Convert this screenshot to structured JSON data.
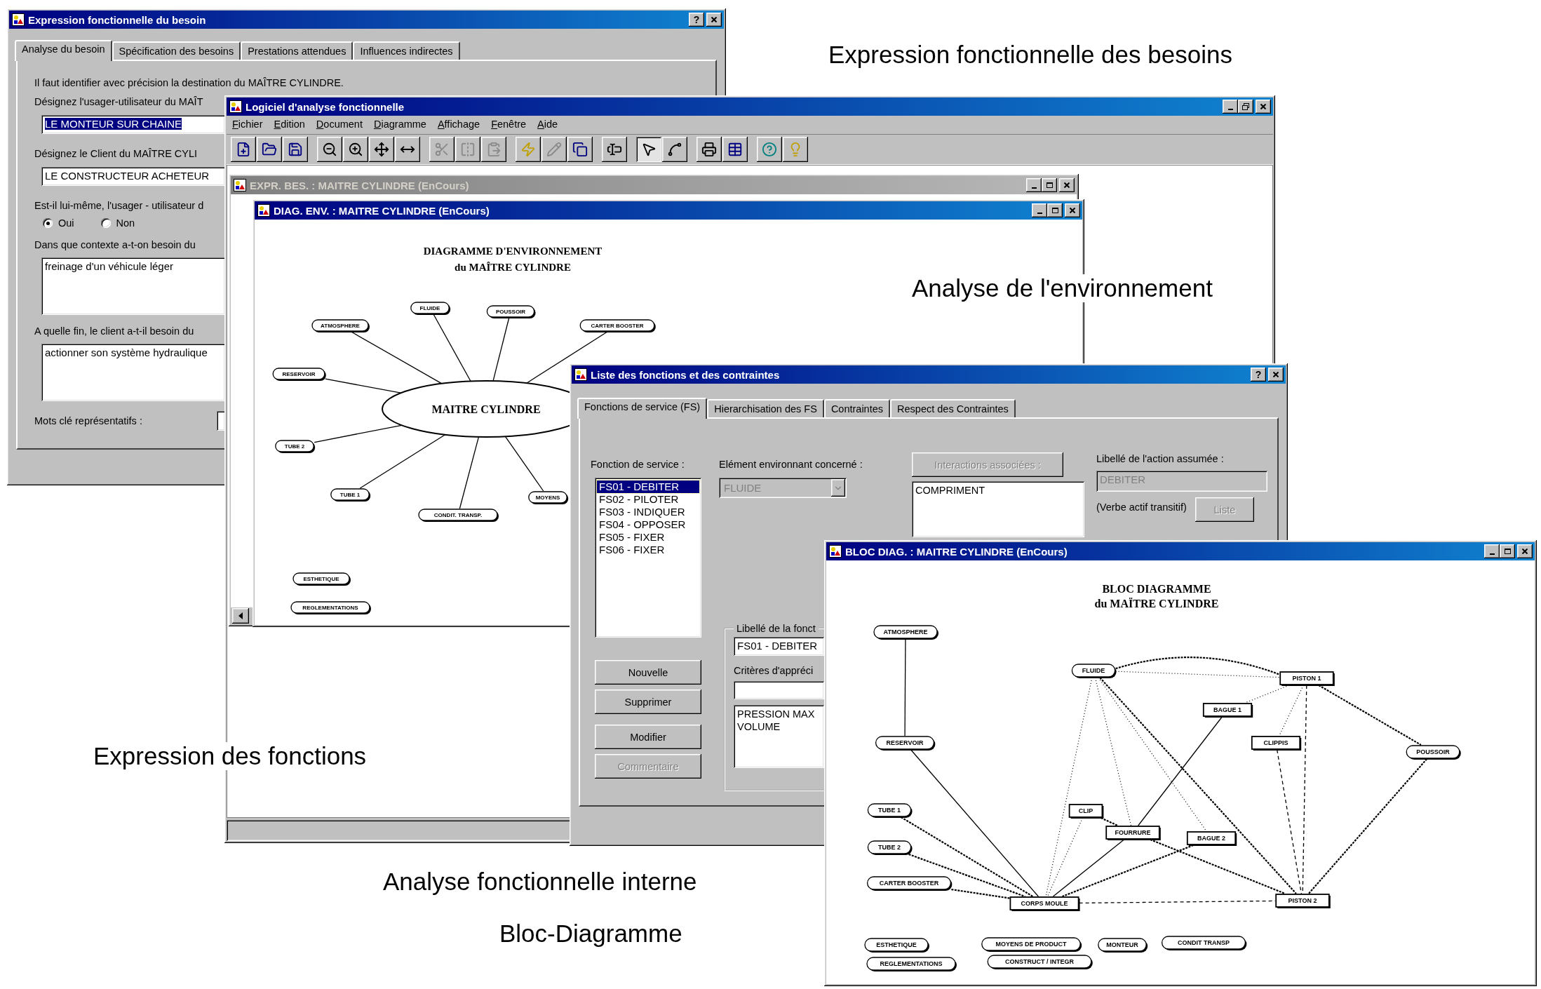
{
  "captions": [
    {
      "text": "Expression fonctionnelle des besoins"
    },
    {
      "text": "Analyse de l'environnement"
    },
    {
      "text": "Expression des fonctions"
    },
    {
      "text": "Analyse fonctionnelle interne"
    },
    {
      "text": "Bloc-Diagramme"
    }
  ],
  "besoin_dialog": {
    "title": "Expression fonctionnelle du besoin",
    "active": true,
    "help_label": "?",
    "tabs": [
      {
        "label": "Analyse du besoin",
        "selected": true
      },
      {
        "label": "Spécification des besoins",
        "selected": false
      },
      {
        "label": "Prestations attendues",
        "selected": false
      },
      {
        "label": "Influences indirectes",
        "selected": false
      }
    ],
    "intro": "Il faut identifier avec précision la destination du MAÎTRE CYLINDRE.",
    "questions": [
      {
        "kind": "line",
        "label": "Désignez l'usager-utilisateur du MAÎT",
        "value": "LE MONTEUR SUR CHAINE",
        "selected": true
      },
      {
        "kind": "line",
        "label": "Désignez le Client du MAÎTRE CYLI",
        "value": "LE CONSTRUCTEUR ACHETEUR",
        "selected": false
      },
      {
        "kind": "radio",
        "label": "Est-il lui-même, l'usager - utilisateur d",
        "options": [
          {
            "label": "Oui",
            "selected": true
          },
          {
            "label": "Non",
            "selected": false
          }
        ]
      },
      {
        "kind": "area",
        "label": "Dans que contexte a-t-on besoin du",
        "value": "freinage d'un véhicule léger"
      },
      {
        "kind": "area",
        "label": "A quelle fin, le client a-t-il besoin du",
        "value": "actionner son système hydraulique"
      },
      {
        "kind": "keywords",
        "label": "Mots clé représentatifs :"
      }
    ]
  },
  "main_window": {
    "title": "Logiciel d'analyse fonctionnelle",
    "active": true,
    "menu": [
      "Fichier",
      "Edition",
      "Document",
      "Diagramme",
      "Affichage",
      "Fenêtre",
      "Aide"
    ],
    "toolbar": [
      {
        "pressed": false,
        "disabled": false
      },
      {
        "pressed": false,
        "disabled": false
      },
      {
        "pressed": false,
        "disabled": false
      },
      {
        "pressed": false,
        "disabled": false
      },
      {
        "pressed": false,
        "disabled": false
      },
      {
        "pressed": false,
        "disabled": false
      },
      {
        "pressed": false,
        "disabled": false
      },
      {
        "pressed": false,
        "disabled": true
      },
      {
        "pressed": false,
        "disabled": true
      },
      {
        "pressed": false,
        "disabled": true
      },
      {
        "pressed": false,
        "disabled": false
      },
      {
        "pressed": false,
        "disabled": true
      },
      {
        "pressed": false,
        "disabled": false
      },
      {
        "pressed": false,
        "disabled": false
      },
      {
        "pressed": true,
        "disabled": false
      },
      {
        "pressed": false,
        "disabled": false
      },
      {
        "pressed": false,
        "disabled": false
      },
      {
        "pressed": false,
        "disabled": false
      },
      {
        "pressed": false,
        "disabled": false
      },
      {
        "pressed": false,
        "disabled": false
      }
    ]
  },
  "expr_bes_window": {
    "title": "EXPR. BES. : MAITRE  CYLINDRE (EnCours)",
    "active": false
  },
  "diag_env_window": {
    "title": "DIAG. ENV. : MAITRE  CYLINDRE (EnCours)",
    "active": true,
    "heading": [
      "DIAGRAMME D'ENVIRONNEMENT",
      "du MAÎTRE  CYLINDRE"
    ],
    "center": "MAITRE  CYLINDRE",
    "nodes": [
      "FLUIDE",
      "POUSSOIR",
      "ATMOSPHERE",
      "CARTER BOOSTER",
      "RESERVOIR",
      "TUBE 2",
      "TUBE 1",
      "CONDIT. TRANSP.",
      "MOYENS",
      "ESTHETIQUE",
      "REGLEMENTATIONS"
    ]
  },
  "liste_dialog": {
    "title": "Liste des fonctions et des contraintes",
    "active": true,
    "help_label": "?",
    "tabs": [
      {
        "label": "Fonctions de service (FS)",
        "selected": true
      },
      {
        "label": "Hierarchisation des FS",
        "selected": false
      },
      {
        "label": "Contraintes",
        "selected": false
      },
      {
        "label": "Respect des Contraintes",
        "selected": false
      }
    ],
    "function_label": "Fonction de service :",
    "functions": [
      {
        "label": "FS01 - DEBITER",
        "selected": true
      },
      {
        "label": "FS02 - PILOTER",
        "selected": false
      },
      {
        "label": "FS03 - INDIQUER",
        "selected": false
      },
      {
        "label": "FS04 - OPPOSER",
        "selected": false
      },
      {
        "label": "FS05 - FIXER",
        "selected": false
      },
      {
        "label": "FS06 - FIXER",
        "selected": false
      }
    ],
    "buttons": [
      {
        "label": "Nouvelle",
        "disabled": false
      },
      {
        "label": "Supprimer",
        "disabled": false
      },
      {
        "label": "Modifier",
        "disabled": false
      },
      {
        "label": "Commentaire",
        "disabled": true
      }
    ],
    "element_label": "Elément environnant concerné :",
    "element": {
      "value": "FLUIDE",
      "disabled": true
    },
    "interactions_button": {
      "label": "Interactions associées :",
      "disabled": true
    },
    "interactions": [
      "COMPRIMENT"
    ],
    "action_label": "Libellé de l'action assumée :",
    "action_value": "DEBITER",
    "verb_hint": "(Verbe actif transitif)",
    "list_button": {
      "label": "Liste",
      "disabled": true
    },
    "group_label": "Libellé de la fonct",
    "function_value": "FS01 - DEBITER",
    "criteria_label": "Critères d'appréci",
    "criteria": [
      "PRESSION MAX",
      "VOLUME"
    ]
  },
  "bloc_diag_window": {
    "title": "BLOC DIAG. : MAITRE  CYLINDRE (EnCours)",
    "active": true,
    "heading": [
      "BLOC DIAGRAMME",
      "du MAÏTRE  CYLINDRE"
    ],
    "nodes": [
      {
        "label": "ATMOSPHERE",
        "kind": "external"
      },
      {
        "label": "RESERVOIR",
        "kind": "external"
      },
      {
        "label": "TUBE 1",
        "kind": "external"
      },
      {
        "label": "TUBE 2",
        "kind": "external"
      },
      {
        "label": "CARTER BOOSTER",
        "kind": "external"
      },
      {
        "label": "CORPS MOULE",
        "kind": "component"
      },
      {
        "label": "FLUIDE",
        "kind": "external"
      },
      {
        "label": "PISTON 1",
        "kind": "component"
      },
      {
        "label": "BAGUE 1",
        "kind": "component"
      },
      {
        "label": "CLIPPIS",
        "kind": "component"
      },
      {
        "label": "POUSSOIR",
        "kind": "external"
      },
      {
        "label": "CLIP",
        "kind": "component"
      },
      {
        "label": "FOURRURE",
        "kind": "component"
      },
      {
        "label": "BAGUE 2",
        "kind": "component"
      },
      {
        "label": "PISTON 2",
        "kind": "component"
      },
      {
        "label": "ESTHETIQUE",
        "kind": "external"
      },
      {
        "label": "REGLEMENTATIONS",
        "kind": "external"
      },
      {
        "label": "MOYENS DE PRODUCT",
        "kind": "external"
      },
      {
        "label": "MONTEUR",
        "kind": "external"
      },
      {
        "label": "CONSTRUCT / INTEGR",
        "kind": "external"
      },
      {
        "label": "CONDIT  TRANSP",
        "kind": "external"
      }
    ]
  }
}
